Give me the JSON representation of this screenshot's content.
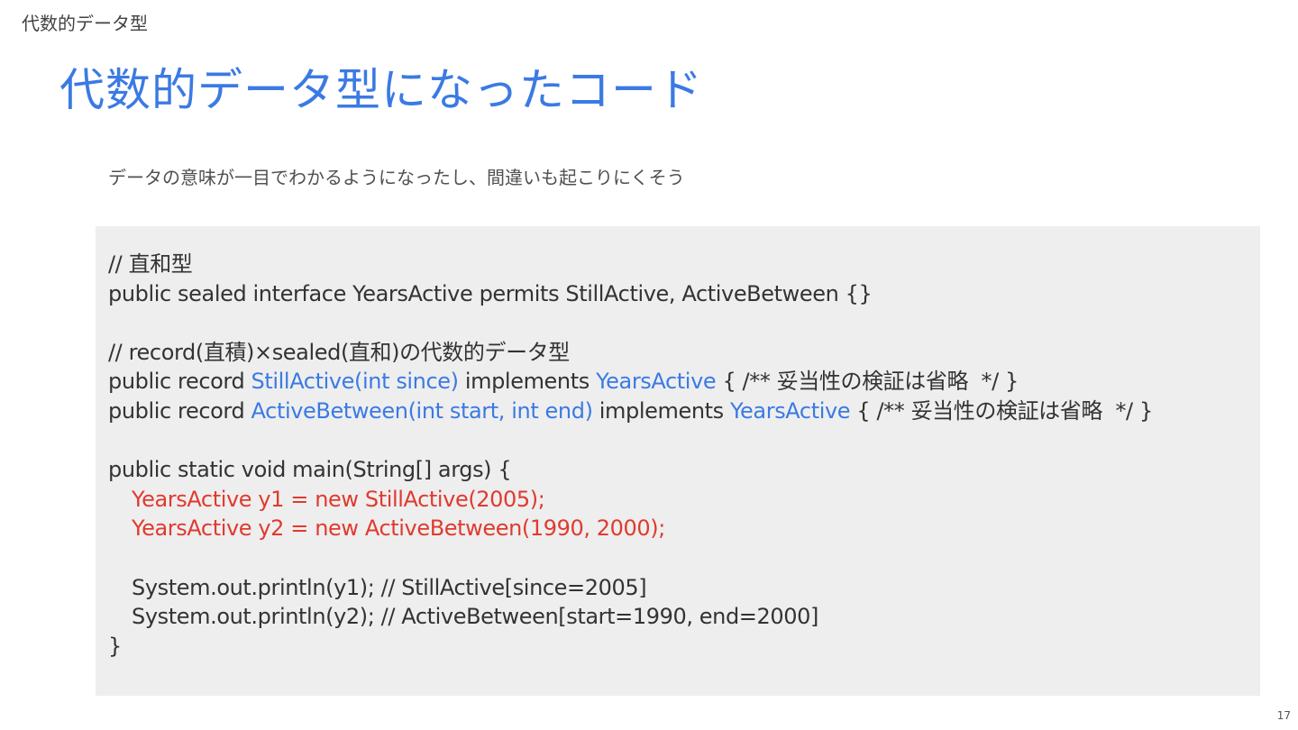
{
  "header": {
    "section_label": "代数的データ型",
    "title": "代数的データ型になったコード",
    "subtitle": "データの意味が一目でわかるようになったし、間違いも起こりにくそう"
  },
  "code": {
    "line1": "// 直和型",
    "line2": "public sealed interface YearsActive permits StillActive, ActiveBetween {}",
    "line4": "// record(直積)×sealed(直和)の代数的データ型",
    "line5_a": "public record ",
    "line5_b": "StillActive(int since)",
    "line5_c": " implements ",
    "line5_d": "YearsActive",
    "line5_e": " { /** 妥当性の検証は省略  */ }",
    "line6_a": "public record ",
    "line6_b": "ActiveBetween(int start, int end)",
    "line6_c": " implements ",
    "line6_d": "YearsActive",
    "line6_e": " { /** 妥当性の検証は省略  */ }",
    "line8": "public static void main(String[] args) {",
    "line9": "YearsActive y1 = new StillActive(2005);",
    "line10": "YearsActive y2 = new ActiveBetween(1990, 2000);",
    "line12": "System.out.println(y1); // StillActive[since=2005]",
    "line13": "System.out.println(y2); // ActiveBetween[start=1990, end=2000]",
    "line14": "}"
  },
  "footer": {
    "page_number": "17"
  },
  "colors": {
    "title_blue": "#3b7ae3",
    "highlight_red": "#e03a2f",
    "code_background": "#eeeeee"
  }
}
